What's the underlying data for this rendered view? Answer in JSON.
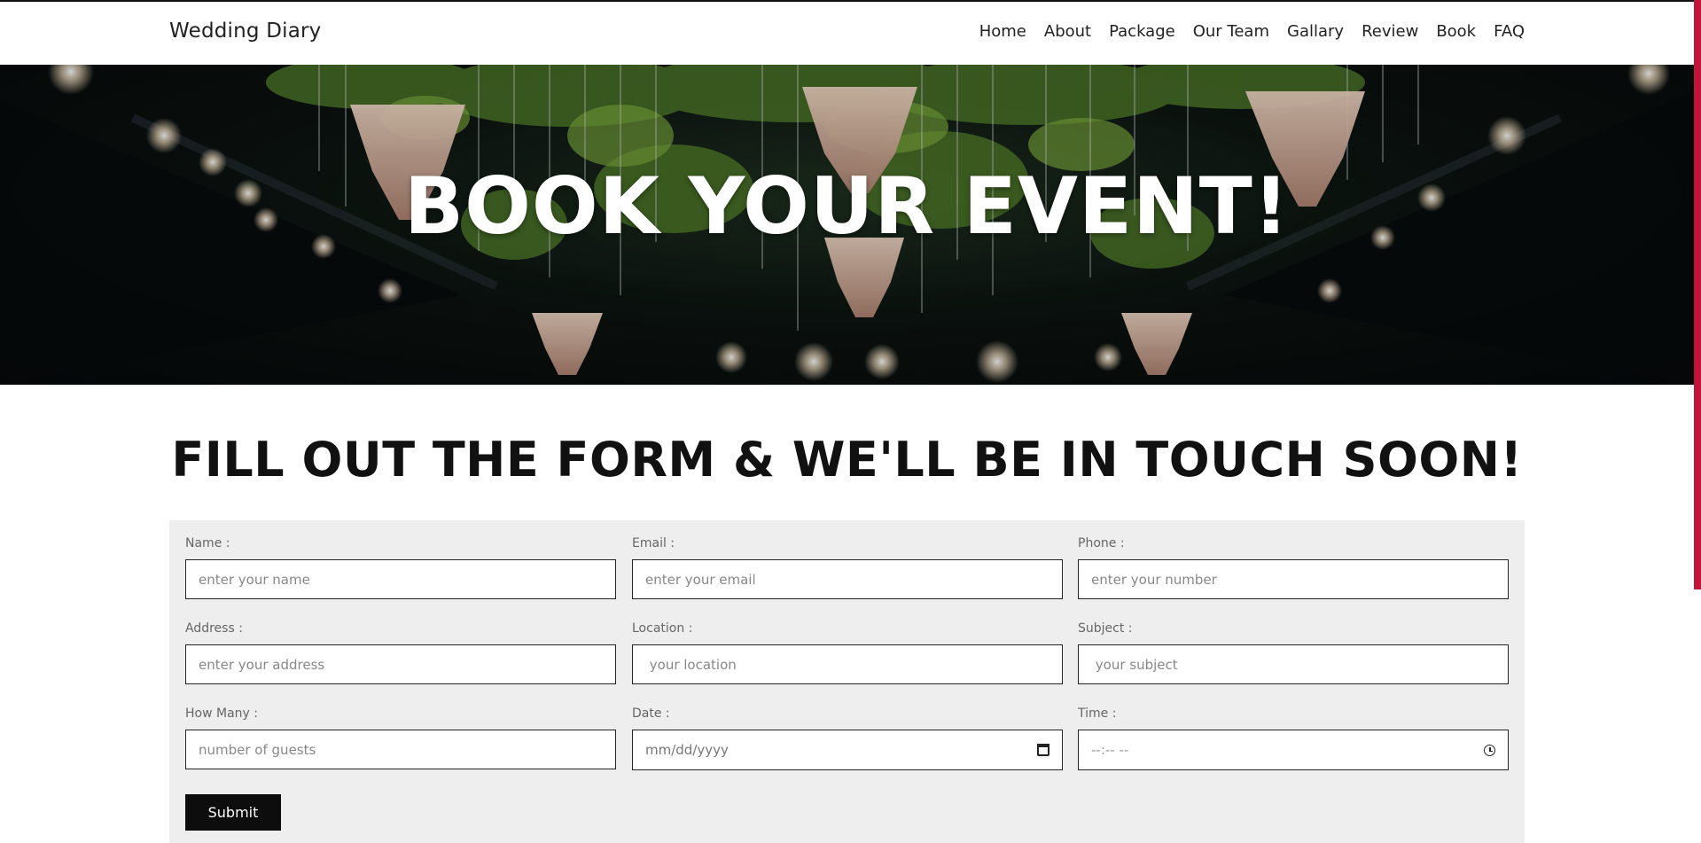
{
  "brand": "Wedding Diary",
  "nav": [
    "Home",
    "About",
    "Package",
    "Our Team",
    "Gallary",
    "Review",
    "Book",
    "FAQ"
  ],
  "hero": {
    "title": "BOOK YOUR EVENT!"
  },
  "section": {
    "title": "FILL OUT THE FORM & WE'LL BE IN TOUCH SOON!"
  },
  "form": {
    "fields": [
      {
        "label": "Name :",
        "placeholder": "enter your name"
      },
      {
        "label": "Email :",
        "placeholder": "enter your email"
      },
      {
        "label": "Phone :",
        "placeholder": "enter your number"
      },
      {
        "label": "Address :",
        "placeholder": "enter your address"
      },
      {
        "label": "Location :",
        "placeholder": " your location"
      },
      {
        "label": "Subject :",
        "placeholder": " your subject"
      },
      {
        "label": "How Many :",
        "placeholder": "number of guests"
      },
      {
        "label": "Date :",
        "placeholder": "mm/dd/yyyy",
        "icon": "calendar-icon"
      },
      {
        "label": "Time :",
        "placeholder": "--:-- --",
        "icon": "clock-icon"
      }
    ],
    "submit_label": "Submit"
  },
  "colors": {
    "accent": "#c2143b",
    "button": "#0d0d0d",
    "form_bg": "#eeeeee"
  }
}
